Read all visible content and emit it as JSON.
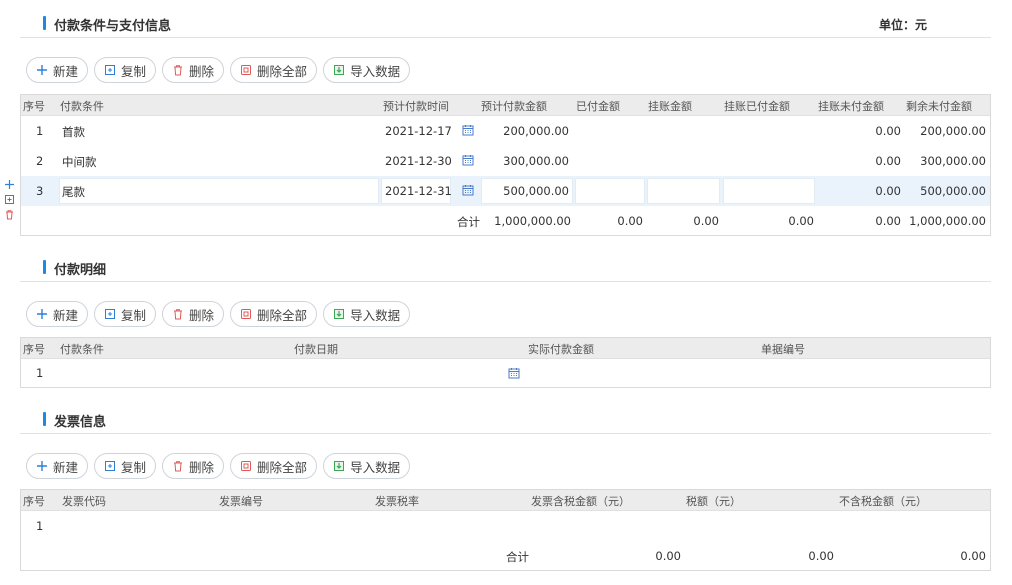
{
  "toolbar": {
    "new": "新建",
    "copy": "复制",
    "delete": "删除",
    "delete_all": "删除全部",
    "import": "导入数据"
  },
  "terms": {
    "title": "付款条件与支付信息",
    "unit": "单位：元",
    "headers": [
      "序号",
      "付款条件",
      "预计付款时间",
      "预计付款金额",
      "已付金额",
      "挂账金额",
      "挂账已付金额",
      "挂账未付金额",
      "剩余未付金额"
    ],
    "rows": [
      {
        "no": "1",
        "cond": "首款",
        "date": "2021-12-17",
        "amount": "200,000.00",
        "unpaid_credit": "0.00",
        "remaining": "200,000.00"
      },
      {
        "no": "2",
        "cond": "中间款",
        "date": "2021-12-30",
        "amount": "300,000.00",
        "unpaid_credit": "0.00",
        "remaining": "300,000.00"
      },
      {
        "no": "3",
        "cond": "尾款",
        "date": "2021-12-31",
        "amount": "500,000.00",
        "unpaid_credit": "0.00",
        "remaining": "500,000.00"
      }
    ],
    "total": {
      "label": "合计",
      "amount": "1,000,000.00",
      "paid": "0.00",
      "credit": "0.00",
      "credit_paid": "0.00",
      "unpaid_credit": "0.00",
      "remaining": "1,000,000.00"
    }
  },
  "details": {
    "title": "付款明细",
    "headers": [
      "序号",
      "付款条件",
      "付款日期",
      "实际付款金额",
      "单据编号"
    ],
    "rows": [
      {
        "no": "1"
      }
    ]
  },
  "invoice": {
    "title": "发票信息",
    "headers": [
      "序号",
      "发票代码",
      "发票编号",
      "发票税率",
      "发票含税金额（元）",
      "税额（元）",
      "不含税金额（元）"
    ],
    "rows": [
      {
        "no": "1"
      }
    ],
    "total": {
      "label": "合计",
      "with_tax": "0.00",
      "tax": "0.00",
      "without_tax": "0.00"
    }
  },
  "colors": {
    "accent": "#1e88e5",
    "selected_row": "#eaf3fc",
    "header_bg": "#ececec"
  }
}
